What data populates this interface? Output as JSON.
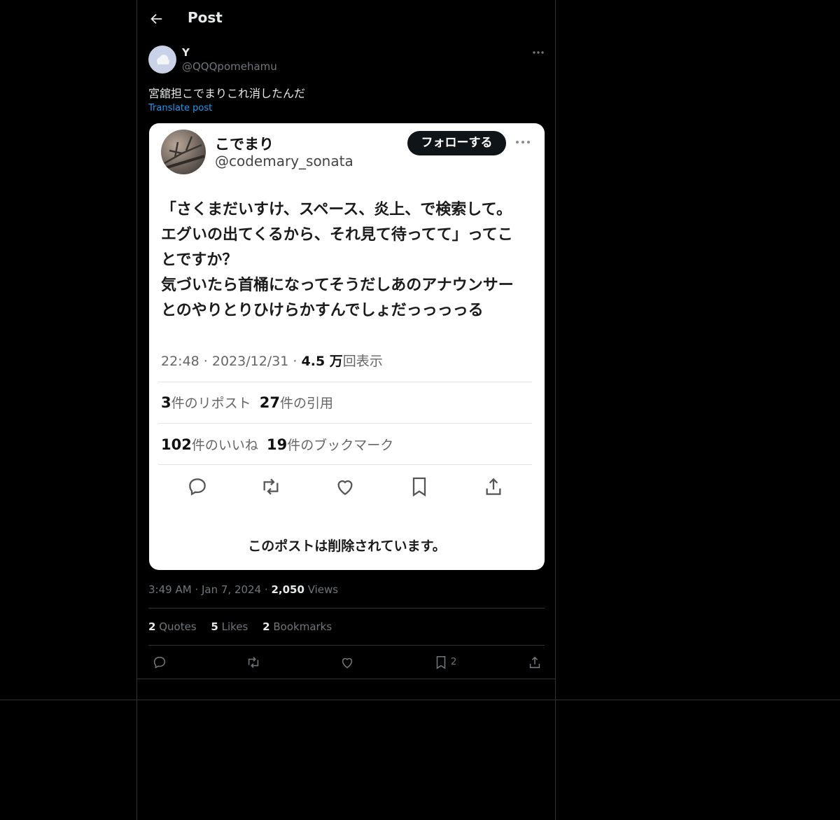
{
  "header": {
    "title": "Post"
  },
  "post": {
    "author": {
      "display_name": "Y",
      "handle": "@QQQpomehamu"
    },
    "text": "宮舘担こでまりこれ消したんだ",
    "translate_label": "Translate post",
    "time": "3:49 AM",
    "date": "Jan 7, 2024",
    "views_count": "2,050",
    "views_label": "Views",
    "stats": [
      {
        "count": "2",
        "label": "Quotes"
      },
      {
        "count": "5",
        "label": "Likes"
      },
      {
        "count": "2",
        "label": "Bookmarks"
      }
    ],
    "bookmark_count": "2"
  },
  "media": {
    "name": "こでまり",
    "handle": "@codemary_sonata",
    "follow_label": "フォローする",
    "body_lines": [
      "「さくまだいすけ、スペース、炎上、で検索して。",
      "エグいの出てくるから、それ見て待ってて」ってこ",
      "とですか？",
      "気づいたら首桶になってそうだしあのアナウンサー",
      "とのやりとりひけらかすんでしょだっっっっる"
    ],
    "meta_time": "22:48 · 2023/12/31 · ",
    "meta_views_num": "4.5 万",
    "meta_views_label": "回表示",
    "reposts_num": "3",
    "reposts_label": "件のリポスト",
    "quotes_num": "27",
    "quotes_label": "件の引用",
    "likes_num": "102",
    "likes_label": "件のいいね",
    "bookmarks_num": "19",
    "bookmarks_label": "件のブックマーク",
    "deleted_label": "このポストは削除されています。"
  },
  "icons": {
    "back": "arrow-left-icon",
    "more": "more-horizontal-icon",
    "reply": "reply-icon",
    "repost": "repost-icon",
    "like": "heart-icon",
    "bookmark": "bookmark-icon",
    "share": "share-icon"
  },
  "colors": {
    "background": "#000000",
    "text": "#e7e9ea",
    "muted": "#71767b",
    "link": "#1d9bf0",
    "border": "#2f3336"
  }
}
